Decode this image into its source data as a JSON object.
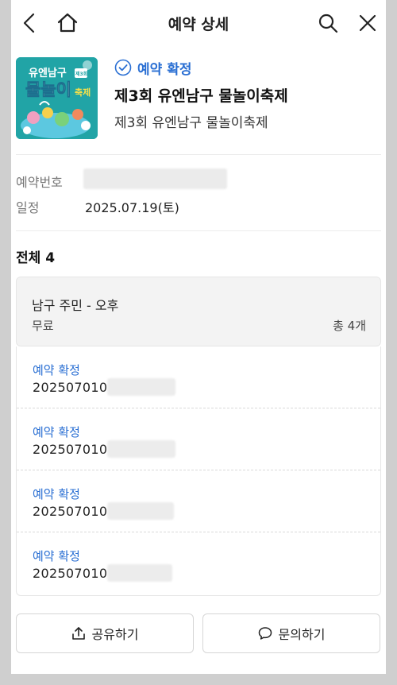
{
  "header": {
    "title": "예약 상세",
    "back_icon": "chevron-left-icon",
    "home_icon": "home-icon",
    "search_icon": "search-icon",
    "close_icon": "close-icon"
  },
  "event": {
    "status": "예약 확정",
    "title": "제3회 유엔남구 물놀이축제",
    "subtitle": "제3회 유엔남구 물놀이축제",
    "poster_text": {
      "line1": "유엔남구",
      "badge": "제3회",
      "line2": "물놀이",
      "line3": "축제"
    }
  },
  "info": {
    "reservation_number_label": "예약번호",
    "date_label": "일정",
    "date_value": "2025.07.19(토)"
  },
  "summary": {
    "total_label": "전체",
    "total_count": "4"
  },
  "ticket": {
    "name": "남구 주민 - 오후",
    "price": "무료",
    "count": "총 4개"
  },
  "items": [
    {
      "status": "예약 확정",
      "code": "202507010"
    },
    {
      "status": "예약 확정",
      "code": "202507010"
    },
    {
      "status": "예약 확정",
      "code": "202507010"
    },
    {
      "status": "예약 확정",
      "code": "202507010"
    }
  ],
  "actions": {
    "share_label": "공유하기",
    "inquiry_label": "문의하기"
  },
  "colors": {
    "accent": "#2a6fd3",
    "poster_bg": "#21a4a6"
  }
}
